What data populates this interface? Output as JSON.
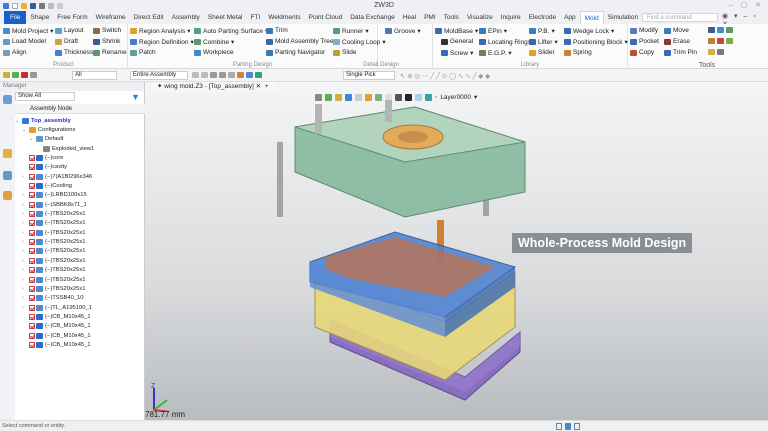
{
  "app": {
    "title": "ZW3D"
  },
  "menu": [
    "File",
    "Shape",
    "Free Form",
    "Wireframe",
    "Direct Edit",
    "Assembly",
    "Sheet Metal",
    "FTI",
    "Weldments",
    "Point Cloud",
    "Data Exchange",
    "Heal",
    "PMI",
    "Tools",
    "Visualize",
    "Inquire",
    "Electrode",
    "App",
    "Mold",
    "Simulation"
  ],
  "menu_active": "Mold",
  "search": {
    "placeholder": "Find a command"
  },
  "ribbon": {
    "product": {
      "label": "Product",
      "items": [
        "Mold Project",
        "Layout",
        "Switch",
        "Load Model",
        "Draft",
        "Shrink",
        "Align",
        "Thickness",
        "Rename"
      ]
    },
    "parting": {
      "label": "Parting Design",
      "items": [
        "Region Analysis",
        "Auto Parting Surface",
        "Trim",
        "Region Definition",
        "Combine",
        "Mold Assembly Tree",
        "Patch",
        "Workpiece",
        "Parting Navigator"
      ]
    },
    "detail": {
      "label": "Detail Design",
      "items": [
        "Runner",
        "Groove",
        "Cooling Loop",
        "Slide"
      ]
    },
    "library": {
      "label": "Library",
      "items": [
        "MoldBase",
        "EPin",
        "P.B.",
        "Wedge Lock",
        "General",
        "Locating Rings",
        "Lifter",
        "Positioning Block",
        "Screw",
        "E.G.P.",
        "Slider",
        "Spring"
      ]
    },
    "tools": {
      "label": "Tools",
      "items": [
        "Modify",
        "Move",
        "Pocket",
        "Erase",
        "Copy",
        "Trim Pin"
      ]
    }
  },
  "toolbar": {
    "filter": "All",
    "scope": "Entire Assembly",
    "pick": "Single Pick"
  },
  "manager": {
    "title": "Manager",
    "show": "Show All",
    "column": "Assembly Node",
    "tree": [
      {
        "label": "Top_assembly",
        "level": 0,
        "exp": "v",
        "cb": false,
        "icon": "assembly"
      },
      {
        "label": "Configurations",
        "level": 1,
        "exp": "v",
        "cb": false,
        "icon": "folder"
      },
      {
        "label": "Default",
        "level": 2,
        "exp": "v",
        "cb": false,
        "icon": "config"
      },
      {
        "label": "Exploded_view1",
        "level": 3,
        "exp": "",
        "cb": false,
        "icon": "explode"
      },
      {
        "label": "(−)core",
        "level": 1,
        "exp": "",
        "cb": true,
        "icon": "part"
      },
      {
        "label": "(−)cavity",
        "level": 1,
        "exp": "",
        "cb": true,
        "icon": "part"
      },
      {
        "label": "(−)7(A1BI296x346",
        "level": 1,
        "exp": ">",
        "cb": true,
        "icon": "sub"
      },
      {
        "label": "(−)Cooling",
        "level": 1,
        "exp": "",
        "cb": true,
        "icon": "part"
      },
      {
        "label": "(−)LRBD100x15",
        "level": 1,
        "exp": ">",
        "cb": true,
        "icon": "sub"
      },
      {
        "label": "(−)SBBK8x71_1",
        "level": 1,
        "exp": ">",
        "cb": true,
        "icon": "sub"
      },
      {
        "label": "(−)TBS20x25x1",
        "level": 1,
        "exp": ">",
        "cb": true,
        "icon": "sub"
      },
      {
        "label": "(−)TBS20x25x1",
        "level": 1,
        "exp": ">",
        "cb": true,
        "icon": "sub"
      },
      {
        "label": "(−)TBS20x25x1",
        "level": 1,
        "exp": ">",
        "cb": true,
        "icon": "sub"
      },
      {
        "label": "(−)TBS20x25x1",
        "level": 1,
        "exp": ">",
        "cb": true,
        "icon": "sub"
      },
      {
        "label": "(−)TBS20x25x1",
        "level": 1,
        "exp": ">",
        "cb": true,
        "icon": "sub"
      },
      {
        "label": "(−)TBS20x25x1",
        "level": 1,
        "exp": ">",
        "cb": true,
        "icon": "sub"
      },
      {
        "label": "(−)TBS20x25x1",
        "level": 1,
        "exp": ">",
        "cb": true,
        "icon": "sub"
      },
      {
        "label": "(−)TBS20x25x1",
        "level": 1,
        "exp": ">",
        "cb": true,
        "icon": "sub"
      },
      {
        "label": "(−)TBS20x25x1",
        "level": 1,
        "exp": ">",
        "cb": true,
        "icon": "sub"
      },
      {
        "label": "(−)TSSB40_10",
        "level": 1,
        "exp": ">",
        "cb": true,
        "icon": "sub"
      },
      {
        "label": "(−)TL_A195100_1",
        "level": 1,
        "exp": ">",
        "cb": true,
        "icon": "sub"
      },
      {
        "label": "(−)CB_M10x45_1",
        "level": 1,
        "exp": "",
        "cb": true,
        "icon": "part"
      },
      {
        "label": "(−)CB_M10x45_1",
        "level": 1,
        "exp": "",
        "cb": true,
        "icon": "part"
      },
      {
        "label": "(−)CB_M10x45_1",
        "level": 1,
        "exp": "",
        "cb": true,
        "icon": "part"
      },
      {
        "label": "(−)CB_M10x45_1",
        "level": 1,
        "exp": "",
        "cb": true,
        "icon": "part"
      }
    ]
  },
  "viewport": {
    "doc_tab": "wing mold.Z3 - [Top_assembly]",
    "layer": "Layer0000",
    "banner": "Whole-Process Mold Design",
    "scale": "781.77 mm"
  },
  "status": {
    "text": "Select command or entity."
  },
  "colors": {
    "accent": "#1a5fc4",
    "cavity": "#7fb89a",
    "core": "#4a7fd0",
    "base_plate": "#8a6fc0",
    "yellow_plate": "#e8d87a",
    "runner": "#d96a2a"
  }
}
